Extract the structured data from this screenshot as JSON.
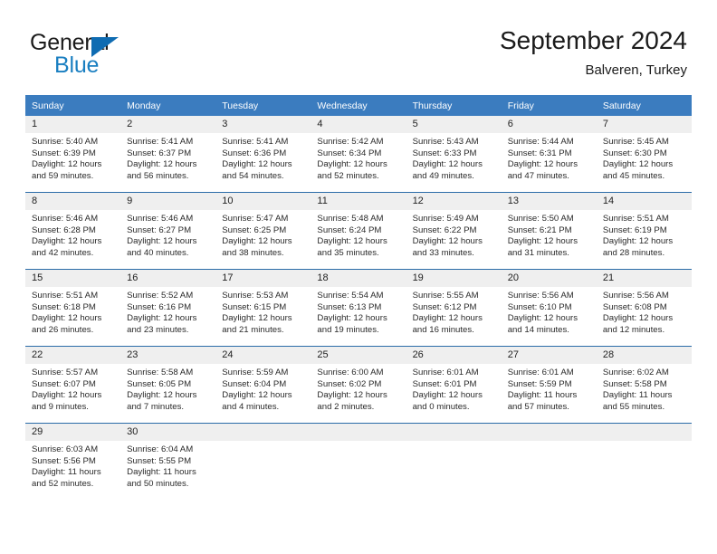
{
  "logo": {
    "word1": "General",
    "word2": "Blue",
    "triangle_color": "#0f6cb2",
    "blue_text_color": "#1a7fc1"
  },
  "header": {
    "title": "September 2024",
    "location": "Balveren, Turkey"
  },
  "theme": {
    "header_blue": "#3b7cbf",
    "row_divider_blue": "#2b6ca8",
    "daynum_band": "#efefef"
  },
  "calendar": {
    "weekday_headers": [
      "Sunday",
      "Monday",
      "Tuesday",
      "Wednesday",
      "Thursday",
      "Friday",
      "Saturday"
    ],
    "weeks": [
      [
        {
          "day": "1",
          "sunrise": "Sunrise: 5:40 AM",
          "sunset": "Sunset: 6:39 PM",
          "daylight1": "Daylight: 12 hours",
          "daylight2": "and 59 minutes."
        },
        {
          "day": "2",
          "sunrise": "Sunrise: 5:41 AM",
          "sunset": "Sunset: 6:37 PM",
          "daylight1": "Daylight: 12 hours",
          "daylight2": "and 56 minutes."
        },
        {
          "day": "3",
          "sunrise": "Sunrise: 5:41 AM",
          "sunset": "Sunset: 6:36 PM",
          "daylight1": "Daylight: 12 hours",
          "daylight2": "and 54 minutes."
        },
        {
          "day": "4",
          "sunrise": "Sunrise: 5:42 AM",
          "sunset": "Sunset: 6:34 PM",
          "daylight1": "Daylight: 12 hours",
          "daylight2": "and 52 minutes."
        },
        {
          "day": "5",
          "sunrise": "Sunrise: 5:43 AM",
          "sunset": "Sunset: 6:33 PM",
          "daylight1": "Daylight: 12 hours",
          "daylight2": "and 49 minutes."
        },
        {
          "day": "6",
          "sunrise": "Sunrise: 5:44 AM",
          "sunset": "Sunset: 6:31 PM",
          "daylight1": "Daylight: 12 hours",
          "daylight2": "and 47 minutes."
        },
        {
          "day": "7",
          "sunrise": "Sunrise: 5:45 AM",
          "sunset": "Sunset: 6:30 PM",
          "daylight1": "Daylight: 12 hours",
          "daylight2": "and 45 minutes."
        }
      ],
      [
        {
          "day": "8",
          "sunrise": "Sunrise: 5:46 AM",
          "sunset": "Sunset: 6:28 PM",
          "daylight1": "Daylight: 12 hours",
          "daylight2": "and 42 minutes."
        },
        {
          "day": "9",
          "sunrise": "Sunrise: 5:46 AM",
          "sunset": "Sunset: 6:27 PM",
          "daylight1": "Daylight: 12 hours",
          "daylight2": "and 40 minutes."
        },
        {
          "day": "10",
          "sunrise": "Sunrise: 5:47 AM",
          "sunset": "Sunset: 6:25 PM",
          "daylight1": "Daylight: 12 hours",
          "daylight2": "and 38 minutes."
        },
        {
          "day": "11",
          "sunrise": "Sunrise: 5:48 AM",
          "sunset": "Sunset: 6:24 PM",
          "daylight1": "Daylight: 12 hours",
          "daylight2": "and 35 minutes."
        },
        {
          "day": "12",
          "sunrise": "Sunrise: 5:49 AM",
          "sunset": "Sunset: 6:22 PM",
          "daylight1": "Daylight: 12 hours",
          "daylight2": "and 33 minutes."
        },
        {
          "day": "13",
          "sunrise": "Sunrise: 5:50 AM",
          "sunset": "Sunset: 6:21 PM",
          "daylight1": "Daylight: 12 hours",
          "daylight2": "and 31 minutes."
        },
        {
          "day": "14",
          "sunrise": "Sunrise: 5:51 AM",
          "sunset": "Sunset: 6:19 PM",
          "daylight1": "Daylight: 12 hours",
          "daylight2": "and 28 minutes."
        }
      ],
      [
        {
          "day": "15",
          "sunrise": "Sunrise: 5:51 AM",
          "sunset": "Sunset: 6:18 PM",
          "daylight1": "Daylight: 12 hours",
          "daylight2": "and 26 minutes."
        },
        {
          "day": "16",
          "sunrise": "Sunrise: 5:52 AM",
          "sunset": "Sunset: 6:16 PM",
          "daylight1": "Daylight: 12 hours",
          "daylight2": "and 23 minutes."
        },
        {
          "day": "17",
          "sunrise": "Sunrise: 5:53 AM",
          "sunset": "Sunset: 6:15 PM",
          "daylight1": "Daylight: 12 hours",
          "daylight2": "and 21 minutes."
        },
        {
          "day": "18",
          "sunrise": "Sunrise: 5:54 AM",
          "sunset": "Sunset: 6:13 PM",
          "daylight1": "Daylight: 12 hours",
          "daylight2": "and 19 minutes."
        },
        {
          "day": "19",
          "sunrise": "Sunrise: 5:55 AM",
          "sunset": "Sunset: 6:12 PM",
          "daylight1": "Daylight: 12 hours",
          "daylight2": "and 16 minutes."
        },
        {
          "day": "20",
          "sunrise": "Sunrise: 5:56 AM",
          "sunset": "Sunset: 6:10 PM",
          "daylight1": "Daylight: 12 hours",
          "daylight2": "and 14 minutes."
        },
        {
          "day": "21",
          "sunrise": "Sunrise: 5:56 AM",
          "sunset": "Sunset: 6:08 PM",
          "daylight1": "Daylight: 12 hours",
          "daylight2": "and 12 minutes."
        }
      ],
      [
        {
          "day": "22",
          "sunrise": "Sunrise: 5:57 AM",
          "sunset": "Sunset: 6:07 PM",
          "daylight1": "Daylight: 12 hours",
          "daylight2": "and 9 minutes."
        },
        {
          "day": "23",
          "sunrise": "Sunrise: 5:58 AM",
          "sunset": "Sunset: 6:05 PM",
          "daylight1": "Daylight: 12 hours",
          "daylight2": "and 7 minutes."
        },
        {
          "day": "24",
          "sunrise": "Sunrise: 5:59 AM",
          "sunset": "Sunset: 6:04 PM",
          "daylight1": "Daylight: 12 hours",
          "daylight2": "and 4 minutes."
        },
        {
          "day": "25",
          "sunrise": "Sunrise: 6:00 AM",
          "sunset": "Sunset: 6:02 PM",
          "daylight1": "Daylight: 12 hours",
          "daylight2": "and 2 minutes."
        },
        {
          "day": "26",
          "sunrise": "Sunrise: 6:01 AM",
          "sunset": "Sunset: 6:01 PM",
          "daylight1": "Daylight: 12 hours",
          "daylight2": "and 0 minutes."
        },
        {
          "day": "27",
          "sunrise": "Sunrise: 6:01 AM",
          "sunset": "Sunset: 5:59 PM",
          "daylight1": "Daylight: 11 hours",
          "daylight2": "and 57 minutes."
        },
        {
          "day": "28",
          "sunrise": "Sunrise: 6:02 AM",
          "sunset": "Sunset: 5:58 PM",
          "daylight1": "Daylight: 11 hours",
          "daylight2": "and 55 minutes."
        }
      ],
      [
        {
          "day": "29",
          "sunrise": "Sunrise: 6:03 AM",
          "sunset": "Sunset: 5:56 PM",
          "daylight1": "Daylight: 11 hours",
          "daylight2": "and 52 minutes."
        },
        {
          "day": "30",
          "sunrise": "Sunrise: 6:04 AM",
          "sunset": "Sunset: 5:55 PM",
          "daylight1": "Daylight: 11 hours",
          "daylight2": "and 50 minutes."
        },
        {
          "day": "",
          "sunrise": "",
          "sunset": "",
          "daylight1": "",
          "daylight2": ""
        },
        {
          "day": "",
          "sunrise": "",
          "sunset": "",
          "daylight1": "",
          "daylight2": ""
        },
        {
          "day": "",
          "sunrise": "",
          "sunset": "",
          "daylight1": "",
          "daylight2": ""
        },
        {
          "day": "",
          "sunrise": "",
          "sunset": "",
          "daylight1": "",
          "daylight2": ""
        },
        {
          "day": "",
          "sunrise": "",
          "sunset": "",
          "daylight1": "",
          "daylight2": ""
        }
      ]
    ]
  }
}
